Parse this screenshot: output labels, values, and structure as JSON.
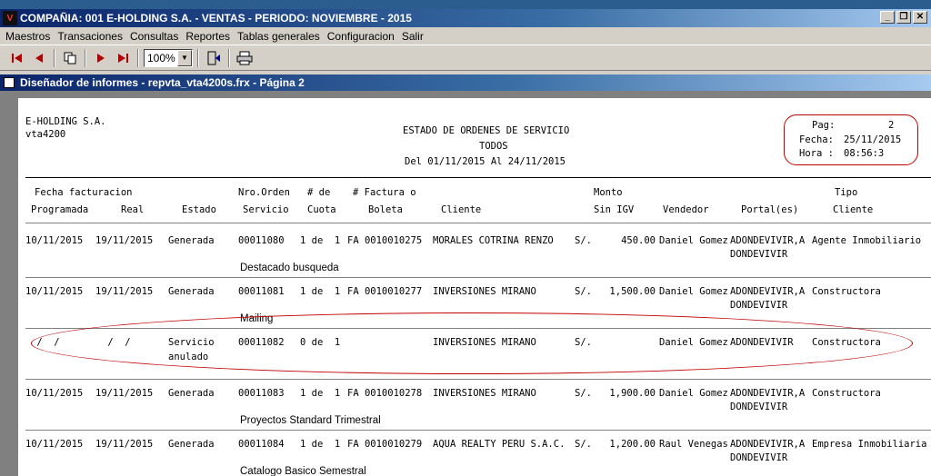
{
  "app": {
    "title": "COMPAÑIA: 001 E-HOLDING S.A.  -  VENTAS  -  PERIODO: NOVIEMBRE - 2015",
    "icon": "app-logo-icon"
  },
  "window_controls": {
    "minimize": "_",
    "restore": "❐",
    "close": "✕"
  },
  "menu": [
    "Maestros",
    "Transaciones",
    "Consultas",
    "Reportes",
    "Tablas generales",
    "Configuracion",
    "Salir"
  ],
  "toolbar": {
    "zoom_value": "100%",
    "buttons": [
      "first-page-icon",
      "prev-page-icon",
      "copy-icon",
      "next-page-icon",
      "last-page-icon",
      "close-preview-icon",
      "print-icon"
    ]
  },
  "report_window": {
    "title": "Diseñador de informes - repvta_vta4200s.frx - Página 2"
  },
  "report": {
    "company": "E-HOLDING S.A.",
    "code": "vta4200",
    "title": "ESTADO DE ORDENES DE SERVICIO",
    "subtitle": "TODOS",
    "range": "Del 01/11/2015 Al 24/11/2015",
    "page_label": "Pag:",
    "page_value": "2",
    "date_label": "Fecha:",
    "date_value": "25/11/2015",
    "time_label": "Hora :",
    "time_value": "08:56:3",
    "headers": {
      "fecha_facturacion": "Fecha facturacion",
      "programada": "Programada",
      "real": "Real",
      "estado": "Estado",
      "nro_orden": "Nro.Orden",
      "servicio": "Servicio",
      "de": "# de",
      "cuota": "Cuota",
      "factura_o": "# Factura o",
      "boleta": "Boleta",
      "cliente": "Cliente",
      "monto": "Monto",
      "sin_igv": "Sin IGV",
      "vendedor": "Vendedor",
      "portales": "Portal(es)",
      "tipo": "Tipo",
      "tipo_cliente": "Cliente"
    },
    "rows": [
      {
        "programada": "10/11/2015",
        "real": "19/11/2015",
        "estado": "Generada",
        "estado2": "",
        "orden": "00011080",
        "cuota": "1 de  1",
        "doc": "FA 0010010275",
        "cliente": "MORALES COTRINA RENZO",
        "moneda": "S/.",
        "monto": "450.00",
        "vendedor": "Daniel Gomez",
        "portal": "ADONDEVIVIR,A",
        "portal2": "DONDEVIVIR",
        "tipo": "Agente Inmobiliario",
        "nota": "Destacado busqueda"
      },
      {
        "programada": "10/11/2015",
        "real": "19/11/2015",
        "estado": "Generada",
        "estado2": "",
        "orden": "00011081",
        "cuota": "1 de  1",
        "doc": "FA 0010010277",
        "cliente": "INVERSIONES MIRANO",
        "moneda": "S/.",
        "monto": "1,500.00",
        "vendedor": "Daniel Gomez",
        "portal": "ADONDEVIVIR,A",
        "portal2": "DONDEVIVIR",
        "tipo": "Constructora",
        "nota": "Mailing"
      },
      {
        "programada": " /  /",
        "real": " /  /",
        "estado": "Servicio",
        "estado2": "anulado",
        "orden": "00011082",
        "cuota": "0 de  1",
        "doc": "",
        "cliente": "INVERSIONES MIRANO",
        "moneda": "S/.",
        "monto": "",
        "vendedor": "Daniel Gomez",
        "portal": "ADONDEVIVIR",
        "portal2": "",
        "tipo": "Constructora",
        "nota": ""
      },
      {
        "programada": "10/11/2015",
        "real": "19/11/2015",
        "estado": "Generada",
        "estado2": "",
        "orden": "00011083",
        "cuota": "1 de  1",
        "doc": "FA 0010010278",
        "cliente": "INVERSIONES MIRANO",
        "moneda": "S/.",
        "monto": "1,900.00",
        "vendedor": "Daniel Gomez",
        "portal": "ADONDEVIVIR,A",
        "portal2": "DONDEVIVIR",
        "tipo": "Constructora",
        "nota": "Proyectos Standard Trimestral"
      },
      {
        "programada": "10/11/2015",
        "real": "19/11/2015",
        "estado": "Generada",
        "estado2": "",
        "orden": "00011084",
        "cuota": "1 de  1",
        "doc": "FA 0010010279",
        "cliente": "AQUA REALTY PERU S.A.C.",
        "moneda": "S/.",
        "monto": "1,200.00",
        "vendedor": "Raul Venegas",
        "portal": "ADONDEVIVIR,A",
        "portal2": "DONDEVIVIR",
        "tipo": "Empresa Inmobiliaria",
        "nota": "Catalogo Basico Semestral"
      }
    ]
  },
  "annotation_color": "#c00000"
}
